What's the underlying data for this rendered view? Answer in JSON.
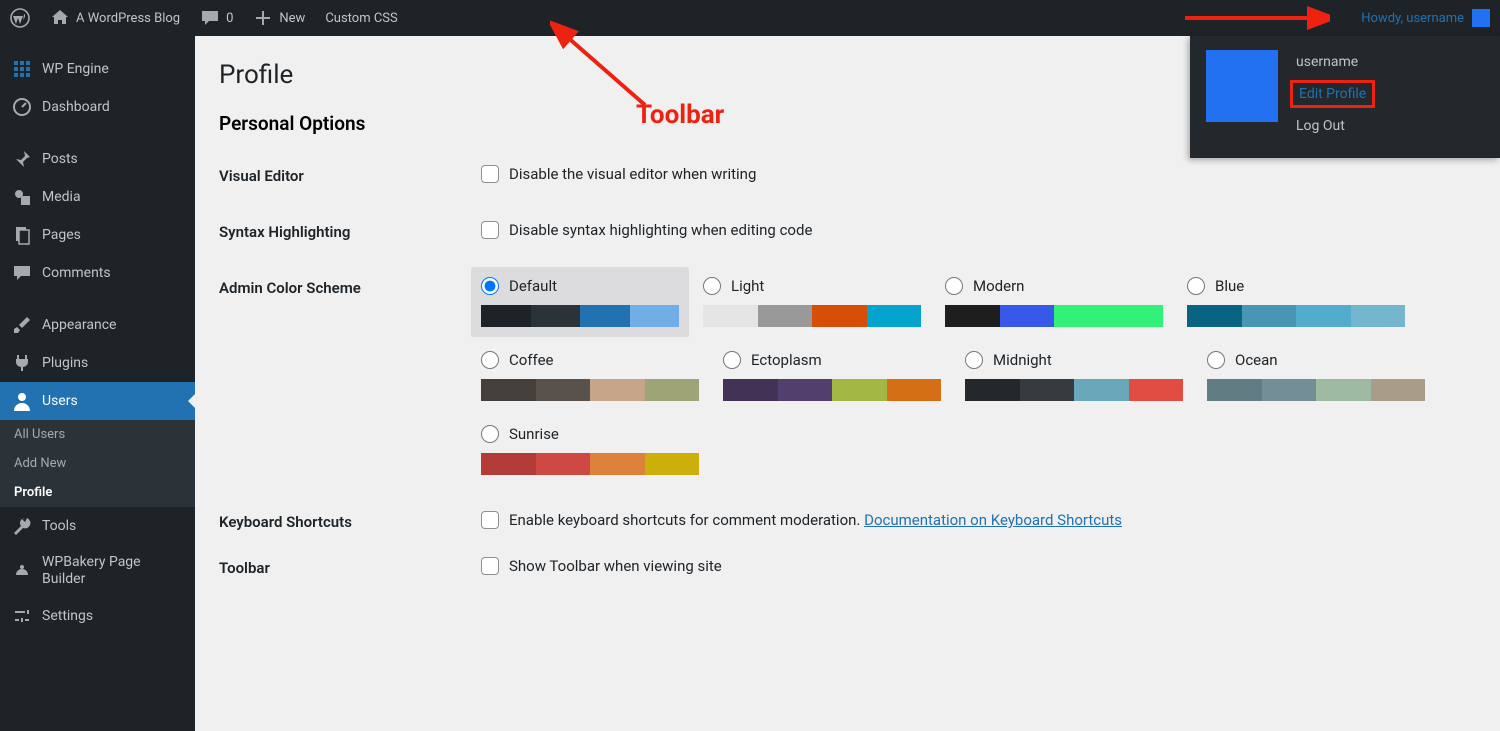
{
  "adminbar": {
    "site_name": "A WordPress Blog",
    "comments_count": "0",
    "new_label": "New",
    "custom_css": "Custom CSS",
    "howdy": "Howdy, username"
  },
  "user_dropdown": {
    "username": "username",
    "edit_profile": "Edit Profile",
    "log_out": "Log Out"
  },
  "sidebar": {
    "wp_engine": "WP Engine",
    "dashboard": "Dashboard",
    "posts": "Posts",
    "media": "Media",
    "pages": "Pages",
    "comments": "Comments",
    "appearance": "Appearance",
    "plugins": "Plugins",
    "users": "Users",
    "users_sub": {
      "all": "All Users",
      "add": "Add New",
      "profile": "Profile"
    },
    "tools": "Tools",
    "wpb": "WPBakery Page Builder",
    "settings": "Settings"
  },
  "page": {
    "title": "Profile",
    "section": "Personal Options",
    "visual_editor": {
      "label": "Visual Editor",
      "chk": "Disable the visual editor when writing"
    },
    "syntax": {
      "label": "Syntax Highlighting",
      "chk": "Disable syntax highlighting when editing code"
    },
    "color_label": "Admin Color Scheme",
    "keyboard": {
      "label": "Keyboard Shortcuts",
      "chk": "Enable keyboard shortcuts for comment moderation. ",
      "link": "Documentation on Keyboard Shortcuts"
    },
    "toolbar": {
      "label": "Toolbar",
      "chk": "Show Toolbar when viewing site"
    }
  },
  "schemes": [
    {
      "name": "Default",
      "selected": true,
      "colors": [
        "#1d2327",
        "#2c3338",
        "#2271b1",
        "#72aee6"
      ]
    },
    {
      "name": "Light",
      "selected": false,
      "colors": [
        "#e5e5e5",
        "#999999",
        "#d64e07",
        "#04a4cc"
      ]
    },
    {
      "name": "Modern",
      "selected": false,
      "colors": [
        "#1e1e1e",
        "#3858e9",
        "#33f078",
        "#33f078"
      ]
    },
    {
      "name": "Blue",
      "selected": false,
      "colors": [
        "#096484",
        "#4796b3",
        "#52accc",
        "#74b6ce"
      ]
    },
    {
      "name": "Coffee",
      "selected": false,
      "colors": [
        "#46403c",
        "#59524c",
        "#c7a589",
        "#9ea476"
      ]
    },
    {
      "name": "Ectoplasm",
      "selected": false,
      "colors": [
        "#413256",
        "#523f6d",
        "#a3b745",
        "#d46f15"
      ]
    },
    {
      "name": "Midnight",
      "selected": false,
      "colors": [
        "#25282b",
        "#363b3f",
        "#69a8bb",
        "#e14d43"
      ]
    },
    {
      "name": "Ocean",
      "selected": false,
      "colors": [
        "#627c83",
        "#738e96",
        "#9ebaa0",
        "#aa9d88"
      ]
    },
    {
      "name": "Sunrise",
      "selected": false,
      "colors": [
        "#b43c38",
        "#cf4944",
        "#dd823b",
        "#ccaf0b"
      ]
    }
  ],
  "annotation": {
    "label": "Toolbar"
  }
}
